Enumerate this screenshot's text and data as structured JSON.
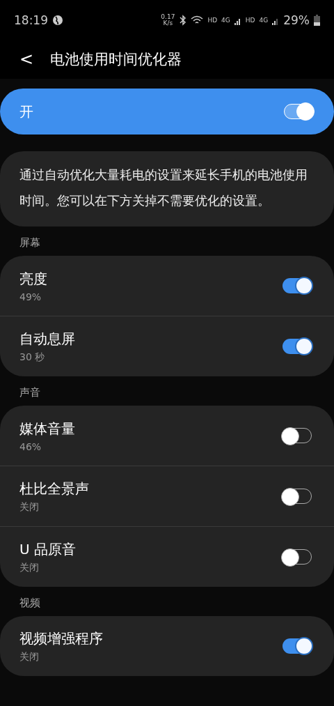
{
  "status_bar": {
    "time": "18:19",
    "net_speed": "0.17 K/s",
    "sim1_hd": "HD",
    "sim1_net": "4G",
    "sim2_hd": "HD",
    "sim2_net": "4G",
    "battery": "29%"
  },
  "header": {
    "back": "<",
    "title": "电池使用时间优化器"
  },
  "master_switch": {
    "label": "开",
    "on": true
  },
  "description": "通过自动优化大量耗电的设置来延长手机的电池使用时间。您可以在下方关掉不需要优化的设置。",
  "sections": [
    {
      "title": "屏幕",
      "items": [
        {
          "label": "亮度",
          "summary": "49%",
          "on": true
        },
        {
          "label": "自动息屏",
          "summary": "30 秒",
          "on": true
        }
      ]
    },
    {
      "title": "声音",
      "items": [
        {
          "label": "媒体音量",
          "summary": "46%",
          "on": false
        },
        {
          "label": "杜比全景声",
          "summary": "关闭",
          "on": false
        },
        {
          "label": "U 品原音",
          "summary": "关闭",
          "on": false
        }
      ]
    },
    {
      "title": "视频",
      "items": [
        {
          "label": "视频增强程序",
          "summary": "关闭",
          "on": true
        }
      ]
    }
  ]
}
